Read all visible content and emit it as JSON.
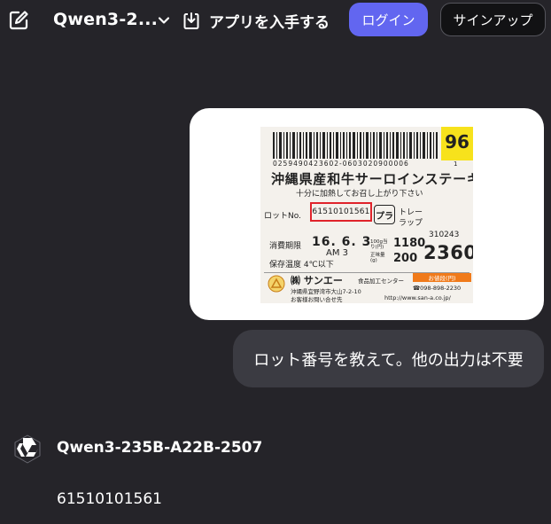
{
  "header": {
    "model_name": "Qwen3-2...",
    "get_app_label": "アプリを入手する",
    "login_label": "ログイン",
    "signup_label": "サインアップ"
  },
  "conversation": {
    "user_image": {
      "label": {
        "barcode_number": "0259490423602-0603020900006",
        "badge_number": "96",
        "badge_sub": "1",
        "product_name": "沖縄県産和牛サーロインステーキ",
        "heating_note": "十分に加熱してお召し上がり下さい",
        "lot_label": "ロットNo.",
        "lot_number": "61510101561",
        "recycle_mark": "プラ",
        "recycle_text_1": "トレー",
        "recycle_text_2": "ラップ",
        "expiry_label": "消費期限",
        "expiry_date": "16. 6. 3",
        "expiry_time": "AM 3",
        "storage_temp": "保存温度 4℃以下",
        "price_per_100g_label": "100g当り(円)",
        "price_per_100g": "1180",
        "net_weight_label": "正味量(g)",
        "net_weight": "200",
        "product_code": "310243",
        "total_price": "2360",
        "company": "㈱ サンエー",
        "food_center": "食品加工センター",
        "price_tag": "お値段(円)",
        "address": "沖縄県宜野湾市大山7-2-10",
        "phone": "☎098-898-2230",
        "inquiry": "お客様お問い合せ先",
        "website": "http://www.san-a.co.jp/"
      }
    },
    "user_message": "ロット番号を教えて。他の出力は不要",
    "assistant": {
      "name": "Qwen3-235B-A22B-2507",
      "answer": "61510101561"
    }
  },
  "colors": {
    "background": "#252429",
    "login_button": "#6266f0",
    "user_bubble": "#3b3b42",
    "lot_highlight": "#e0232b",
    "badge": "#f7e21c"
  },
  "icons": [
    "edit-icon",
    "chevron-down-icon",
    "download-app-icon",
    "qwen-logo-icon"
  ]
}
